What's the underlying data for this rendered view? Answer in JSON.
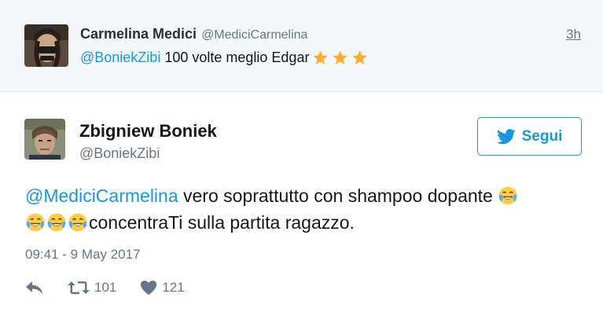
{
  "parent_tweet": {
    "author_name": "Carmelina Medici",
    "author_handle": "@MediciCarmelina",
    "time": "3h",
    "mention": "@BoniekZibi",
    "text": " 100 volte meglio Edgar",
    "emoji": [
      "star",
      "star",
      "star"
    ]
  },
  "main_tweet": {
    "author_name": "Zbigniew Boniek",
    "author_handle": "@BoniekZibi",
    "follow_label": "Segui",
    "mention": "@MediciCarmelina",
    "text_part1": " vero soprattutto con shampoo dopante ",
    "text_part2": "concentraTi sulla partita ragazzo.",
    "emoji": [
      "face-with-tears-of-joy",
      "face-with-tears-of-joy",
      "face-with-tears-of-joy",
      "face-with-tears-of-joy"
    ],
    "timestamp": "09:41 - 9 May 2017",
    "retweet_count": "101",
    "like_count": "121"
  },
  "icons": {
    "reply": "reply-icon",
    "retweet": "retweet-icon",
    "like": "heart-icon",
    "follow": "twitter-bird-icon"
  },
  "colors": {
    "accent": "#1b95e0",
    "muted": "#657786",
    "parent_background": "#f5f8fa",
    "star": "#ffac33",
    "emoji_face": "#ffcc4d",
    "tears": "#5dadec"
  }
}
